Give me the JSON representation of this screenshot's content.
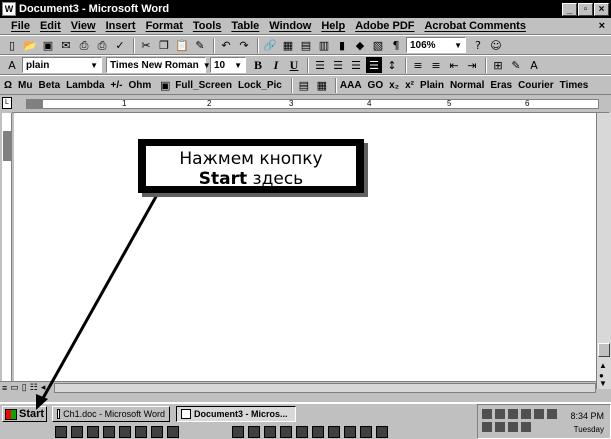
{
  "window": {
    "title": "Document3 - Microsoft Word",
    "app_icon": "W"
  },
  "menu": [
    "File",
    "Edit",
    "View",
    "Insert",
    "Format",
    "Tools",
    "Table",
    "Window",
    "Help",
    "Adobe PDF",
    "Acrobat Comments"
  ],
  "menu_close": "×",
  "standard_toolbar": {
    "zoom": "106%"
  },
  "formatting_toolbar": {
    "style": "plain",
    "font": "Times New Roman",
    "size": "10",
    "bold": "B",
    "italic": "I",
    "underline": "U"
  },
  "symbol_toolbar": {
    "items": [
      "Ω",
      "Mu",
      "Beta",
      "Lambda",
      "+/-",
      "Ohm",
      "Full_Screen",
      "Lock_Pic"
    ],
    "items2": [
      "AAA",
      "GO",
      "x₂",
      "x²",
      "Plain",
      "Normal",
      "Eras",
      "Courier",
      "Times"
    ]
  },
  "ruler": {
    "numbers": [
      "1",
      "2",
      "3",
      "4",
      "5",
      "6"
    ]
  },
  "callout": {
    "line1": "Нажмем кнопку",
    "line2_bold": "Start",
    "line2_rest": " здесь"
  },
  "taskbar": {
    "start_label": "Start",
    "buttons": [
      "Ch1.doc - Microsoft Word",
      "Document3 - Micros..."
    ],
    "clock": "8:34 PM",
    "day": "Tuesday"
  },
  "colors": {
    "title_bar": "#000000",
    "chrome": "#c0c0c0",
    "document": "#ffffff"
  }
}
